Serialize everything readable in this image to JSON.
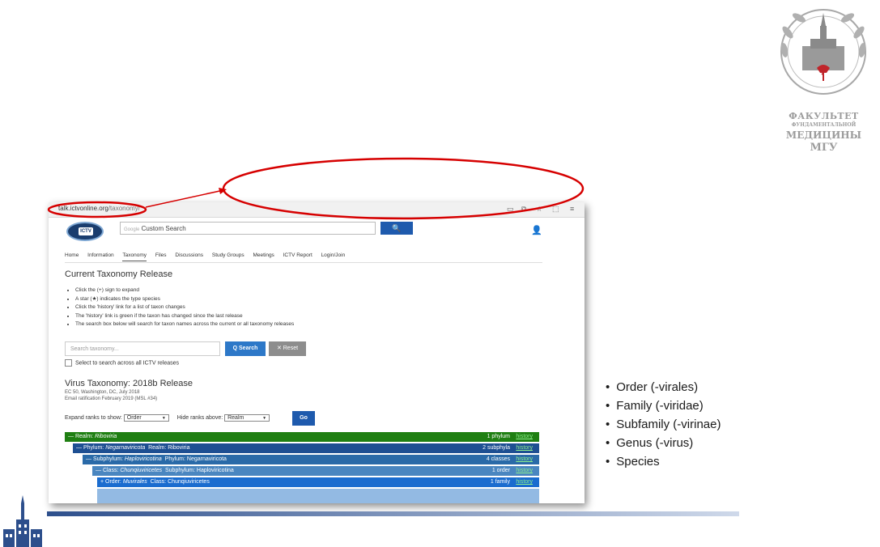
{
  "slide": {
    "logo_text": [
      "ФАКУЛЬТЕТ",
      "ФУНДАМЕНТАЛЬНОЙ",
      "МЕДИЦИНЫ",
      "МГУ"
    ],
    "bullets": [
      "Order (-virales)",
      "Family (-viridae)",
      "Subfamily (-virinae)",
      "Genus (-virus)",
      "Species"
    ]
  },
  "browser": {
    "url_host": "talk.ictvonline.org",
    "url_path": "/taxonomy/",
    "toolbar_icons": [
      "reader-icon",
      "share-icon",
      "star-icon",
      "extensions-icon",
      "menu-icon"
    ]
  },
  "site": {
    "logo_label": "ICTV",
    "search_brand": "Google",
    "search_placeholder": "Custom Search",
    "search_button": "🔍",
    "nav": [
      "Home",
      "Information",
      "Taxonomy",
      "Files",
      "Discussions",
      "Study Groups",
      "Meetings",
      "ICTV Report",
      "Login/Join"
    ],
    "active_nav": "Taxonomy"
  },
  "page": {
    "title": "Current Taxonomy Release",
    "instructions": [
      "Click the (+) sign to expand",
      "A star (★) indicates the type species",
      "Click the 'history' link for a list of taxon changes",
      "The 'history' link is green if the taxon has changed since the last release",
      "The search box below will search for taxon names across the current or all taxonomy releases"
    ],
    "search_placeholder": "Search taxonomy...",
    "search_button": "Q Search",
    "reset_button": "✕ Reset",
    "checkbox_label": "Select to search across all ICTV releases",
    "release_title": "Virus Taxonomy: 2018b Release",
    "release_meta1": "EC 50, Washington, DC, July 2018",
    "release_meta2": "Email ratification February 2019 (MSL #34)",
    "expand_label": "Expand ranks to show:",
    "expand_value": "Order",
    "hide_label": "Hide ranks above:",
    "hide_value": "Realm",
    "go_button": "Go"
  },
  "tree": [
    {
      "prefix": "— Realm: ",
      "name": "Riboviria",
      "parent": "",
      "count": "1 phylum",
      "history": "history",
      "color": "#1f7f12"
    },
    {
      "prefix": "— Phylum: ",
      "name": "Negarnaviricota",
      "parent": "Realm: Riboviria",
      "count": "2 subphyla",
      "history": "history",
      "color": "#1e4f92"
    },
    {
      "prefix": "— Subphylum: ",
      "name": "Haploviricotina",
      "parent": "Phylum: Negarnaviricota",
      "count": "4 classes",
      "history": "history",
      "color": "#2a6aa8"
    },
    {
      "prefix": "— Class: ",
      "name": "Chunqiuviricetes",
      "parent": "Subphylum: Haploviricotina",
      "count": "1 order",
      "history": "history",
      "color": "#4a86c0"
    },
    {
      "prefix": "+ Order: ",
      "name": "Muvirales",
      "parent": "Class: Chunqiuviricetes",
      "count": "1 family",
      "history": "history",
      "color": "#1a6ccf"
    }
  ],
  "colors": {
    "accent_blue": "#1e5aad",
    "annotation_red": "#d60000"
  }
}
